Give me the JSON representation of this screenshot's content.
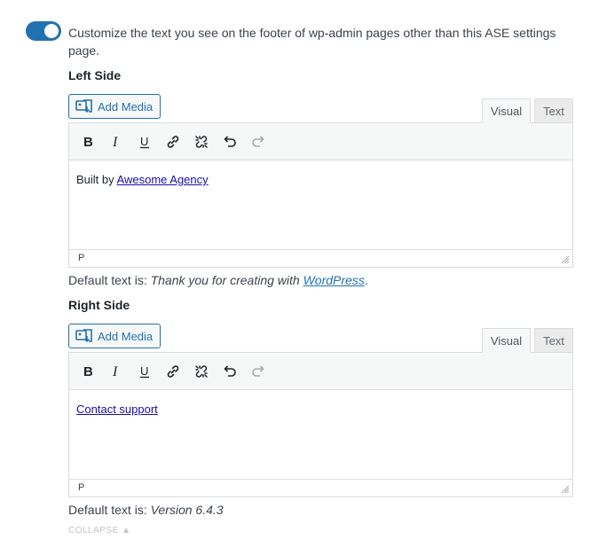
{
  "toggle": {
    "state": "on",
    "label": "Customize the text you see on the footer of wp-admin pages other than this ASE settings page."
  },
  "left_side": {
    "title": "Left Side",
    "add_media_label": "Add Media",
    "tabs": {
      "visual": "Visual",
      "text": "Text"
    },
    "content_prefix": "Built by ",
    "content_link": "Awesome Agency",
    "status_path": "P",
    "default_prefix": "Default text is: ",
    "default_italic": "Thank you for creating with ",
    "default_link": "WordPress",
    "default_suffix": "."
  },
  "right_side": {
    "title": "Right Side",
    "add_media_label": "Add Media",
    "tabs": {
      "visual": "Visual",
      "text": "Text"
    },
    "content_link": "Contact support",
    "status_path": "P",
    "default_prefix": "Default text is: ",
    "default_italic": "Version 6.4.3"
  },
  "toolbar_icons": [
    "bold-icon",
    "italic-icon",
    "underline-icon",
    "link-icon",
    "unlink-icon",
    "undo-icon",
    "redo-icon"
  ],
  "collapse_label": "COLLAPSE",
  "colors": {
    "accent": "#2271b1",
    "link": "#1a0dab",
    "border": "#dcdcde"
  }
}
